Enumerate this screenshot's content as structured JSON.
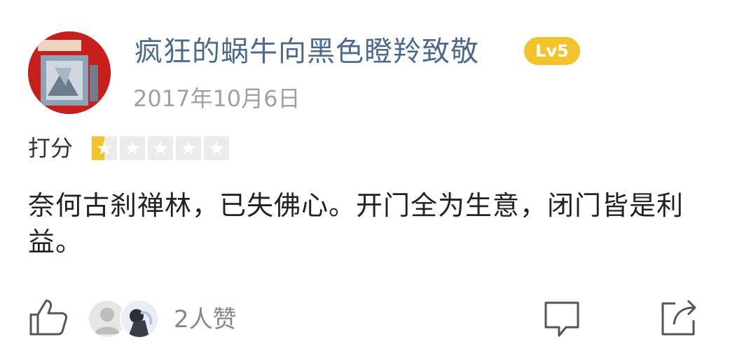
{
  "user": {
    "name": "疯狂的蜗牛向黑色瞪羚致敬",
    "level": "Lv5",
    "avatar_icon": "user-avatar-icon"
  },
  "post": {
    "date": "2017年10月6日",
    "rating_label": "打分",
    "rating": 1,
    "rating_max": 5,
    "text": "奈何古刹禅林，已失佛心。开门全为生意，闭门皆是利益。"
  },
  "actions": {
    "like_icon": "thumbs-up-icon",
    "like_count_text": "2人赞",
    "comment_icon": "comment-icon",
    "share_icon": "share-icon"
  },
  "colors": {
    "username": "#4d6a8c",
    "badge": "#f3c32b",
    "star_on": "#f3c32b",
    "star_off": "#ececec",
    "date": "#a0a0a0"
  }
}
